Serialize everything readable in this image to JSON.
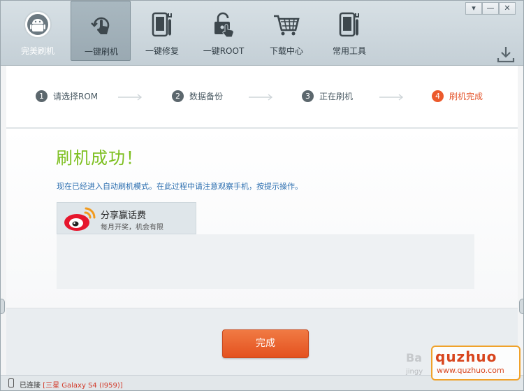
{
  "nav": {
    "items": [
      {
        "label": "完美刷机",
        "icon": "android-icon"
      },
      {
        "label": "一键刷机",
        "icon": "refresh-hand-icon"
      },
      {
        "label": "一键修复",
        "icon": "phone-wrench-icon"
      },
      {
        "label": "一键ROOT",
        "icon": "lock-hand-icon"
      },
      {
        "label": "下载中心",
        "icon": "shopping-cart-icon"
      },
      {
        "label": "常用工具",
        "icon": "tools-icon"
      }
    ]
  },
  "window_controls": {
    "menu": "▾",
    "minimize": "—",
    "close": "✕"
  },
  "steps": [
    {
      "num": "1",
      "label": "请选择ROM"
    },
    {
      "num": "2",
      "label": "数据备份"
    },
    {
      "num": "3",
      "label": "正在刷机"
    },
    {
      "num": "4",
      "label": "刷机完成"
    }
  ],
  "content": {
    "title": "刷机成功！",
    "description": "现在已经进入自动刷机模式。在此过程中请注意观察手机，按提示操作。",
    "share": {
      "title": "分享赢话费",
      "subtitle": "每月开奖，机会有限"
    }
  },
  "done_button": "完成",
  "status": {
    "prefix": "已连接",
    "device": "[三星 Galaxy S4 (I959)]"
  },
  "watermark": {
    "brand": "quzhuo",
    "url": "www.quzhuo.com",
    "bai": "Ba",
    "jingyan": "jingy"
  },
  "colors": {
    "accent": "#ec5a2c",
    "success": "#7cbf1e",
    "link": "#2c6fb0"
  }
}
